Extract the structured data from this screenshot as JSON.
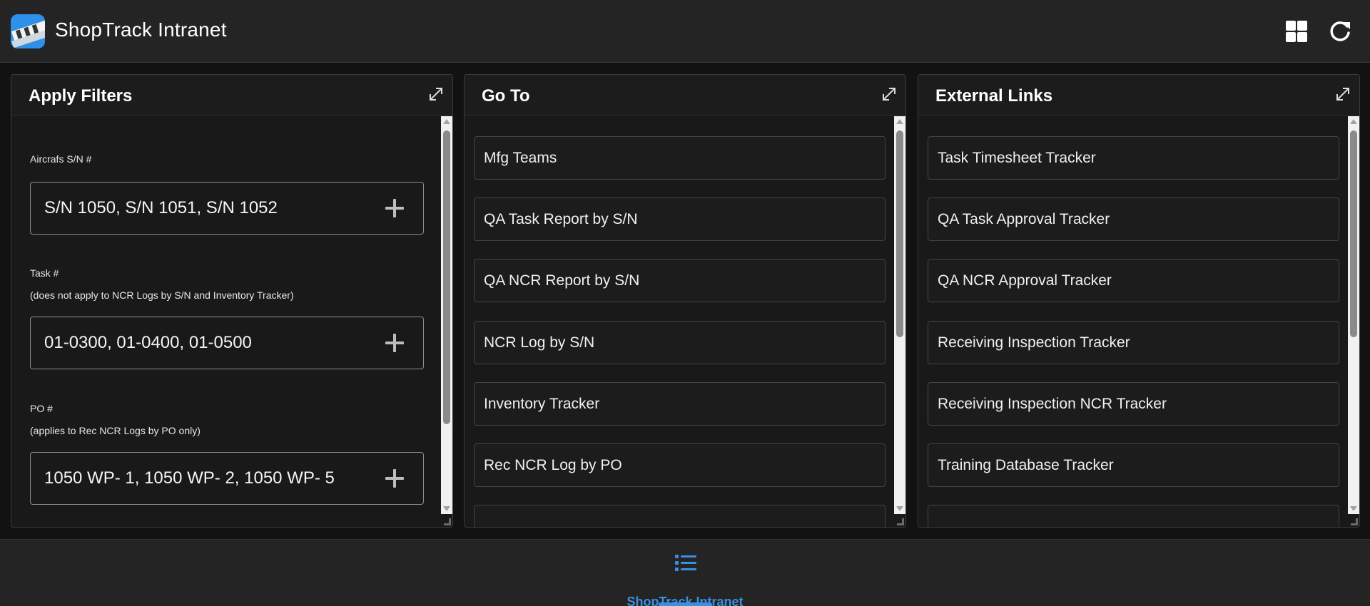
{
  "app": {
    "title": "ShopTrack Intranet",
    "accent_color": "#3b8fe0",
    "header_icons": [
      "grid-layout-icon",
      "refresh-icon"
    ]
  },
  "filters_panel": {
    "title": "Apply Filters",
    "fields": [
      {
        "label": "Aircrafs S/N #",
        "note": "",
        "value": "S/N 1050, S/N 1051, S/N 1052"
      },
      {
        "label": "Task #",
        "note": "(does not apply to NCR Logs by S/N and Inventory Tracker)",
        "value": "01-0300, 01-0400, 01-0500"
      },
      {
        "label": "PO #",
        "note": "(applies to Rec NCR Logs by PO only)",
        "value": "1050 WP- 1, 1050 WP- 2, 1050 WP- 5"
      }
    ]
  },
  "goto_panel": {
    "title": "Go To",
    "items": [
      "Mfg Teams",
      "QA Task Report by S/N",
      "QA NCR Report by S/N",
      "NCR Log by S/N",
      "Inventory Tracker",
      "Rec NCR Log by PO",
      ""
    ]
  },
  "links_panel": {
    "title": "External Links",
    "items": [
      "Task Timesheet Tracker",
      "QA Task Approval Tracker",
      "QA NCR Approval Tracker",
      "Receiving Inspection Tracker",
      "Receiving Inspection NCR Tracker",
      "Training Database Tracker",
      ""
    ]
  },
  "footer": {
    "tab_label": "ShopTrack Intranet",
    "tab_icon": "list-icon"
  }
}
